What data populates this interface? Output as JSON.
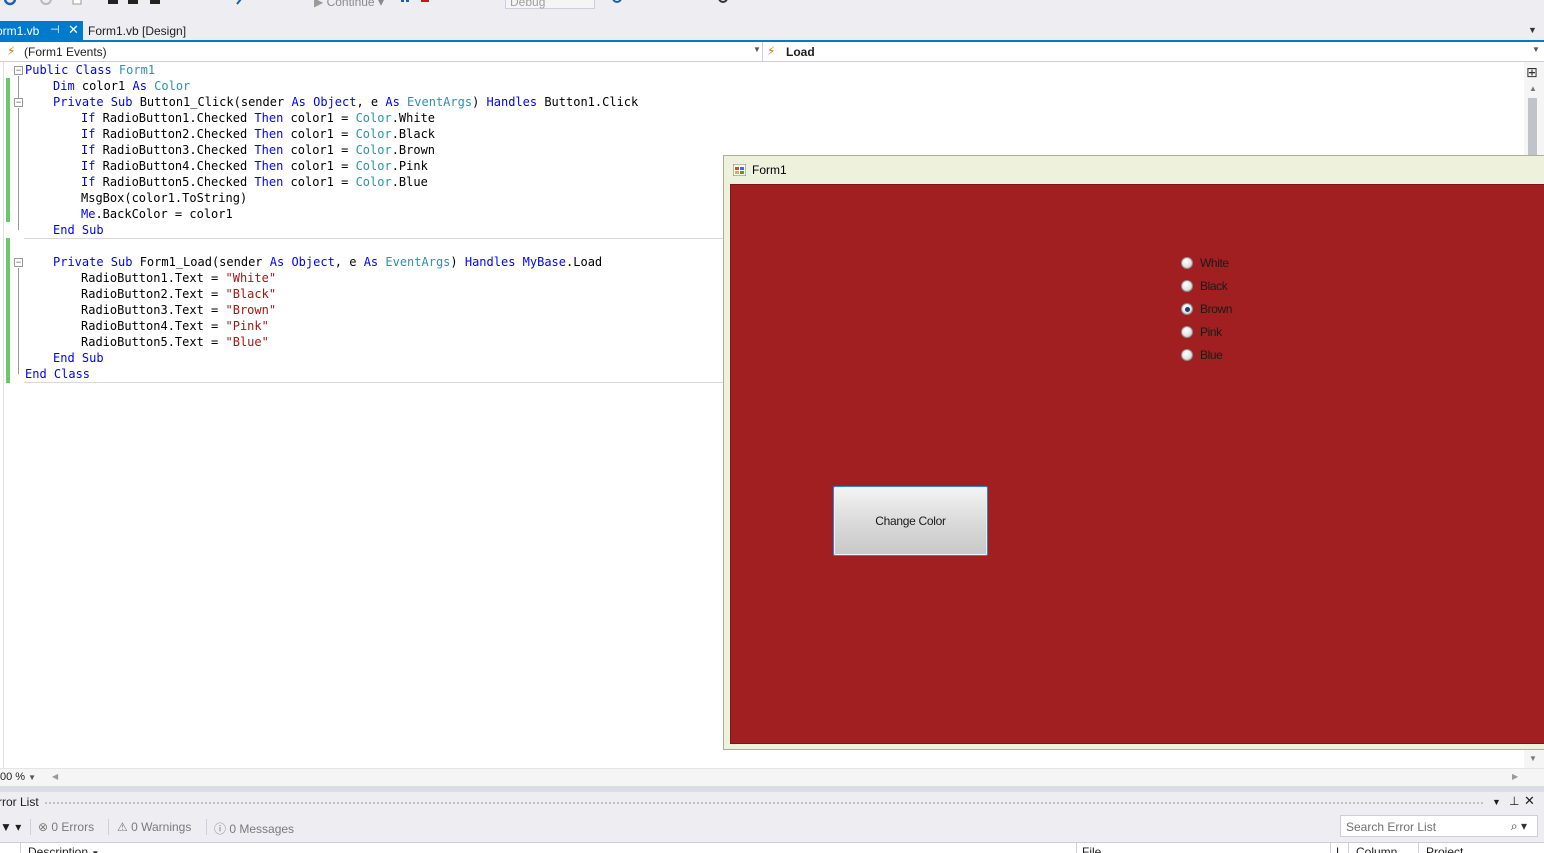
{
  "toolbar": {
    "continue_label": "Continue",
    "config_value": "Debug"
  },
  "tabs": [
    {
      "label": "orm1.vb",
      "active": true
    },
    {
      "label": "Form1.vb [Design]",
      "active": false
    }
  ],
  "navbar": {
    "left_value": "(Form1 Events)",
    "right_value": "Load"
  },
  "code": {
    "l1": {
      "a": "Public Class",
      "b": " Form1"
    },
    "l2": {
      "a": "Dim",
      "b": " color1 ",
      "c": "As",
      "d": " Color"
    },
    "l3": {
      "a": "Private Sub",
      "b": " Button1_Click(sender ",
      "c": "As",
      "d": " Object",
      "e": ", e ",
      "f": "As",
      "g": " EventArgs",
      "h": ") ",
      "i": "Handles",
      "j": " Button1.Click"
    },
    "l4": {
      "a": "If",
      "b": " RadioButton1.Checked ",
      "c": "Then",
      "d": " color1 = ",
      "e": "Color",
      "f": ".White"
    },
    "l5": {
      "a": "If",
      "b": " RadioButton2.Checked ",
      "c": "Then",
      "d": " color1 = ",
      "e": "Color",
      "f": ".Black"
    },
    "l6": {
      "a": "If",
      "b": " RadioButton3.Checked ",
      "c": "Then",
      "d": " color1 = ",
      "e": "Color",
      "f": ".Brown"
    },
    "l7": {
      "a": "If",
      "b": " RadioButton4.Checked ",
      "c": "Then",
      "d": " color1 = ",
      "e": "Color",
      "f": ".Pink"
    },
    "l8": {
      "a": "If",
      "b": " RadioButton5.Checked ",
      "c": "Then",
      "d": " color1 = ",
      "e": "Color",
      "f": ".Blue"
    },
    "l9": {
      "a": "MsgBox(color1.ToString)"
    },
    "l10": {
      "a": "Me",
      "b": ".BackColor = color1"
    },
    "l11": {
      "a": "End Sub"
    },
    "l12": {
      "a": "Private Sub",
      "b": " Form1_Load(sender ",
      "c": "As",
      "d": " Object",
      "e": ", e ",
      "f": "As",
      "g": " EventArgs",
      "h": ") ",
      "i": "Handles",
      "j": " MyBase",
      "k": ".Load"
    },
    "l13": {
      "a": "RadioButton1.Text = ",
      "b": "\"White\""
    },
    "l14": {
      "a": "RadioButton2.Text = ",
      "b": "\"Black\""
    },
    "l15": {
      "a": "RadioButton3.Text = ",
      "b": "\"Brown\""
    },
    "l16": {
      "a": "RadioButton4.Text = ",
      "b": "\"Pink\""
    },
    "l17": {
      "a": "RadioButton5.Text = ",
      "b": "\"Blue\""
    },
    "l18": {
      "a": "End Sub"
    },
    "l19": {
      "a": "End Class"
    }
  },
  "zoom": "00 %",
  "form": {
    "title": "Form1",
    "back_color": "#a11f21",
    "radios": [
      {
        "label": "White",
        "checked": false
      },
      {
        "label": "Black",
        "checked": false
      },
      {
        "label": "Brown",
        "checked": true
      },
      {
        "label": "Pink",
        "checked": false
      },
      {
        "label": "Blue",
        "checked": false
      }
    ],
    "button_label": "Change Color"
  },
  "error_list": {
    "title": "rror List",
    "errors": "0 Errors",
    "warnings": "0 Warnings",
    "messages": "0 Messages",
    "search_placeholder": "Search Error List",
    "columns": [
      "Description",
      "File",
      "L",
      "Column",
      "Project"
    ]
  },
  "colors": {
    "accent": "#007acc",
    "keyword": "#0000ff",
    "type": "#2b91af",
    "string": "#a31515",
    "change_marker": "#6cc66c"
  }
}
